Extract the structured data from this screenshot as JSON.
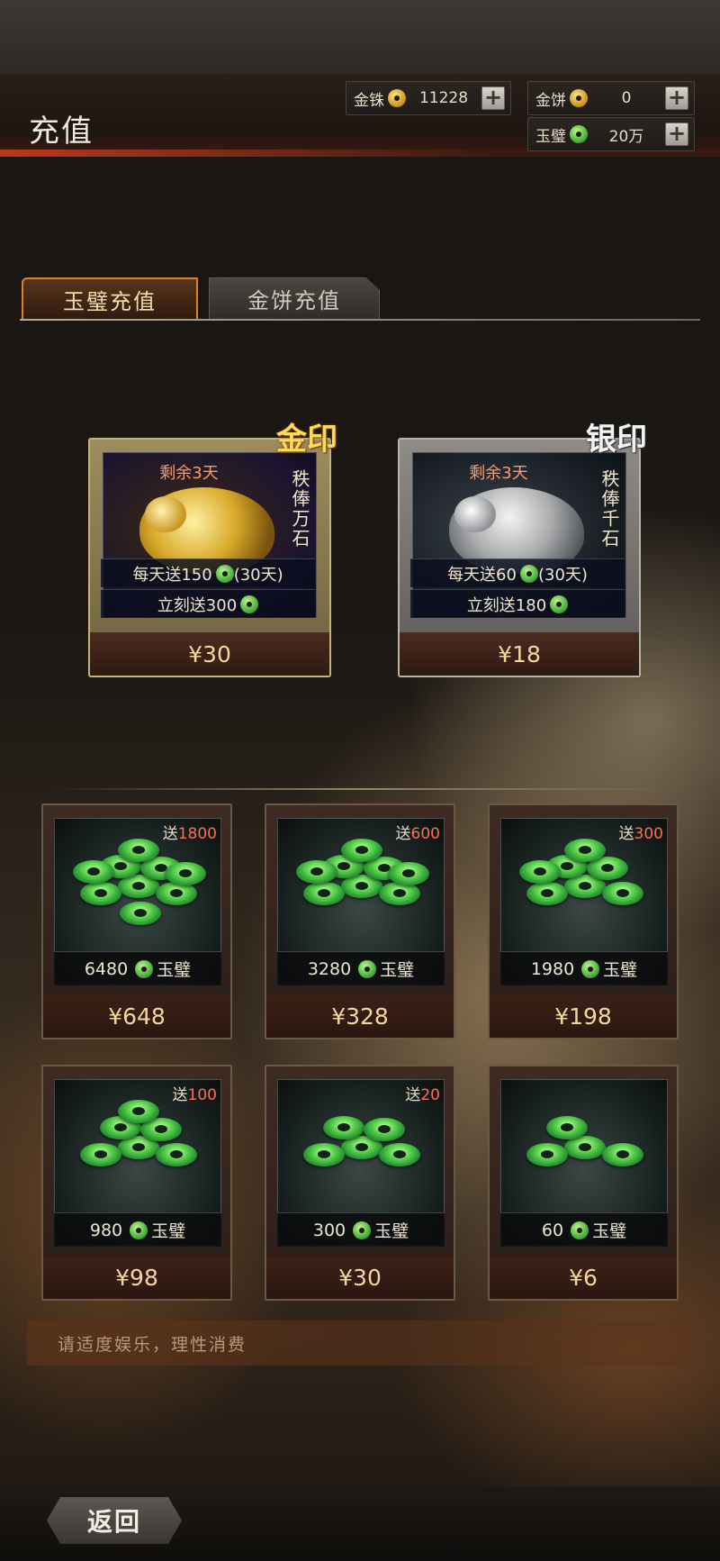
{
  "header": {
    "title": "充值"
  },
  "currencies": [
    {
      "label": "金铢",
      "value": "11228",
      "icon": "gold-coin-icon"
    },
    {
      "label": "金饼",
      "value": "0",
      "icon": "gold-cake-icon"
    },
    {
      "label": "玉璧",
      "value": "20万",
      "icon": "jade-icon"
    }
  ],
  "tabs": [
    {
      "label": "玉璧充值",
      "active": true
    },
    {
      "label": "金饼充值",
      "active": false
    }
  ],
  "monthly_cards": [
    {
      "seal": "金印",
      "remaining": "剩余3天",
      "vertical_text": "秩俸万石",
      "daily": "每天送150",
      "daily_suffix": "(30天)",
      "instant": "立刻送300",
      "price": "¥30"
    },
    {
      "seal": "银印",
      "remaining": "剩余3天",
      "vertical_text": "秩俸千石",
      "daily": "每天送60",
      "daily_suffix": "(30天)",
      "instant": "立刻送180",
      "price": "¥18"
    }
  ],
  "packs": [
    {
      "bonus_prefix": "送",
      "bonus": "1800",
      "amount": "6480",
      "unit": "玉璧",
      "price": "¥648"
    },
    {
      "bonus_prefix": "送",
      "bonus": "600",
      "amount": "3280",
      "unit": "玉璧",
      "price": "¥328"
    },
    {
      "bonus_prefix": "送",
      "bonus": "300",
      "amount": "1980",
      "unit": "玉璧",
      "price": "¥198"
    },
    {
      "bonus_prefix": "送",
      "bonus": "100",
      "amount": "980",
      "unit": "玉璧",
      "price": "¥98"
    },
    {
      "bonus_prefix": "送",
      "bonus": "20",
      "amount": "300",
      "unit": "玉璧",
      "price": "¥30"
    },
    {
      "bonus_prefix": "",
      "bonus": "",
      "amount": "60",
      "unit": "玉璧",
      "price": "¥6"
    }
  ],
  "notice": "请适度娱乐，理性消费",
  "footer": {
    "back_label": "返回"
  },
  "colors": {
    "accent": "#d9822e",
    "bonus": "#ff6e55",
    "jade": "#4cb340",
    "gold": "#c89118"
  }
}
